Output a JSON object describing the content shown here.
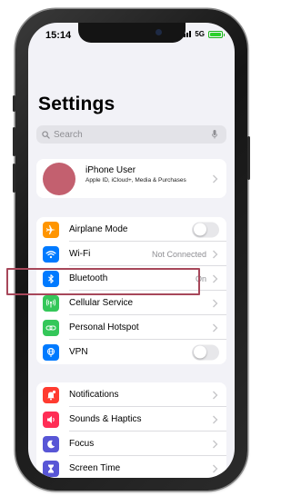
{
  "status_bar": {
    "time": "15:14",
    "network": "5G"
  },
  "header": {
    "title": "Settings"
  },
  "search": {
    "placeholder": "Search"
  },
  "profile": {
    "name": "iPhone User",
    "subtitle": "Apple ID, iCloud+, Media & Purchases"
  },
  "group1": [
    {
      "label": "Airplane Mode",
      "icon": "airplane-icon",
      "color": "#ff9500",
      "toggle": false
    },
    {
      "label": "Wi-Fi",
      "icon": "wifi-icon",
      "color": "#007aff",
      "value": "Not Connected"
    },
    {
      "label": "Bluetooth",
      "icon": "bluetooth-icon",
      "color": "#007aff",
      "value": "On"
    },
    {
      "label": "Cellular Service",
      "icon": "cellular-icon",
      "color": "#34c759"
    },
    {
      "label": "Personal Hotspot",
      "icon": "hotspot-icon",
      "color": "#34c759"
    },
    {
      "label": "VPN",
      "icon": "vpn-icon",
      "color": "#007aff",
      "toggle": false
    }
  ],
  "group2": [
    {
      "label": "Notifications",
      "icon": "notifications-icon",
      "color": "#ff3b30"
    },
    {
      "label": "Sounds & Haptics",
      "icon": "sounds-icon",
      "color": "#ff2d55"
    },
    {
      "label": "Focus",
      "icon": "focus-icon",
      "color": "#5856d6"
    },
    {
      "label": "Screen Time",
      "icon": "screen-time-icon",
      "color": "#5856d6"
    }
  ],
  "highlight_color": "#a7475a"
}
